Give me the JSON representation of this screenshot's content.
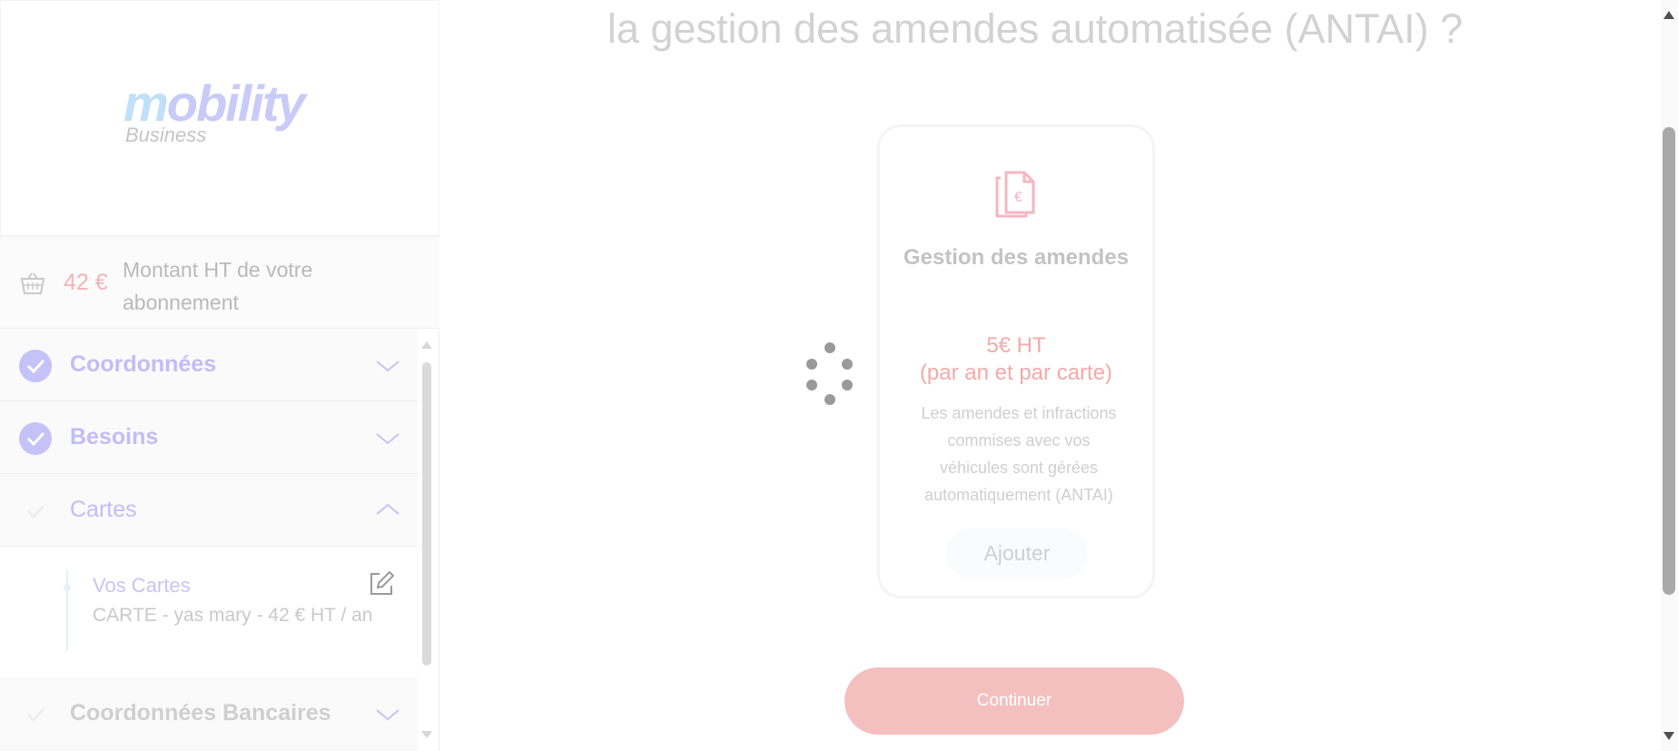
{
  "brand": {
    "name_part1": "m",
    "name_part2": "obility",
    "sub": "Business"
  },
  "basket": {
    "icon": "basket-icon",
    "amount": "42 €",
    "label": "Montant HT de votre abonnement"
  },
  "steps": [
    {
      "label": "Coordonnées",
      "status": "done",
      "expanded": false
    },
    {
      "label": "Besoins",
      "status": "done",
      "expanded": false
    },
    {
      "label": "Cartes",
      "status": "active",
      "expanded": true
    },
    {
      "label": "Coordonnées Bancaires",
      "status": "todo",
      "expanded": false
    }
  ],
  "cards_section": {
    "title": "Vos Cartes",
    "item": "CARTE - yas mary - 42 € HT / an"
  },
  "main": {
    "heading": "la gestion des amendes automatisée (ANTAI) ?",
    "option": {
      "icon": "euro-document-icon",
      "title": "Gestion des amendes",
      "price_line1": "5€ HT",
      "price_line2": "(par an et par carte)",
      "description": "Les amendes et infractions commises avec vos véhicules sont gérées automatiquement (ANTAI)",
      "add_label": "Ajouter"
    },
    "continue_label": "Continuer"
  },
  "colors": {
    "brand_purple": "#c5c2f8",
    "accent_pink": "#f4bfbf"
  }
}
